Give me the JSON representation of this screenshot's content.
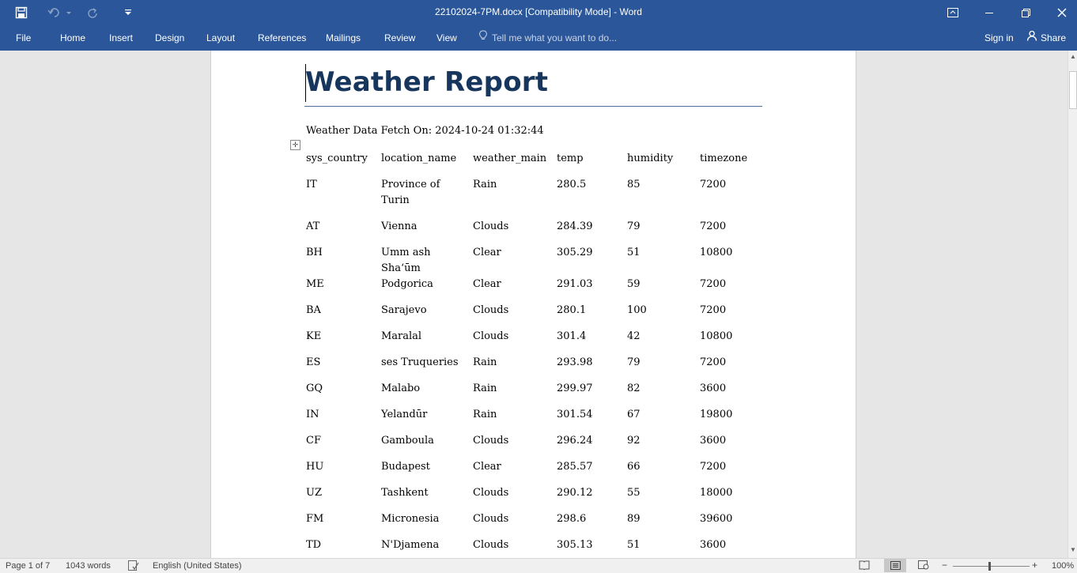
{
  "window": {
    "title": "22102024-7PM.docx [Compatibility Mode] - Word"
  },
  "ribbon": {
    "tabs": [
      {
        "label": "File"
      },
      {
        "label": "Home"
      },
      {
        "label": "Insert"
      },
      {
        "label": "Design"
      },
      {
        "label": "Layout"
      },
      {
        "label": "References"
      },
      {
        "label": "Mailings"
      },
      {
        "label": "Review"
      },
      {
        "label": "View"
      }
    ],
    "tell_me_placeholder": "Tell me what you want to do...",
    "sign_in": "Sign in",
    "share": "Share"
  },
  "document": {
    "title": "Weather Report",
    "fetch_line": "Weather Data Fetch On: 2024-10-24 01:32:44",
    "table": {
      "headers": [
        "sys_country",
        "location_name",
        "weather_main",
        "temp",
        "humidity",
        "timezone"
      ],
      "rows": [
        [
          "IT",
          "Province of Turin",
          "Rain",
          "280.5",
          "85",
          "7200"
        ],
        [
          "AT",
          "Vienna",
          "Clouds",
          "284.39",
          "79",
          "7200"
        ],
        [
          "BH",
          "Umm ash Sha‘ūm",
          "Clear",
          "305.29",
          "51",
          "10800"
        ],
        [
          "ME",
          "Podgorica",
          "Clear",
          "291.03",
          "59",
          "7200"
        ],
        [
          "BA",
          "Sarajevo",
          "Clouds",
          "280.1",
          "100",
          "7200"
        ],
        [
          "KE",
          "Maralal",
          "Clouds",
          "301.4",
          "42",
          "10800"
        ],
        [
          "ES",
          "ses Truqueries",
          "Rain",
          "293.98",
          "79",
          "7200"
        ],
        [
          "GQ",
          "Malabo",
          "Rain",
          "299.97",
          "82",
          "3600"
        ],
        [
          "IN",
          "Yelandūr",
          "Rain",
          "301.54",
          "67",
          "19800"
        ],
        [
          "CF",
          "Gamboula",
          "Clouds",
          "296.24",
          "92",
          "3600"
        ],
        [
          "HU",
          "Budapest",
          "Clear",
          "285.57",
          "66",
          "7200"
        ],
        [
          "UZ",
          "Tashkent",
          "Clouds",
          "290.12",
          "55",
          "18000"
        ],
        [
          "FM",
          "Micronesia",
          "Clouds",
          "298.6",
          "89",
          "39600"
        ],
        [
          "TD",
          "N'Djamena",
          "Clouds",
          "305.13",
          "51",
          "3600"
        ]
      ]
    }
  },
  "status": {
    "page": "Page 1 of 7",
    "words": "1043 words",
    "language": "English (United States)",
    "zoom": "100%"
  },
  "colors": {
    "ribbon": "#2b579a",
    "title_text": "#17365d"
  }
}
